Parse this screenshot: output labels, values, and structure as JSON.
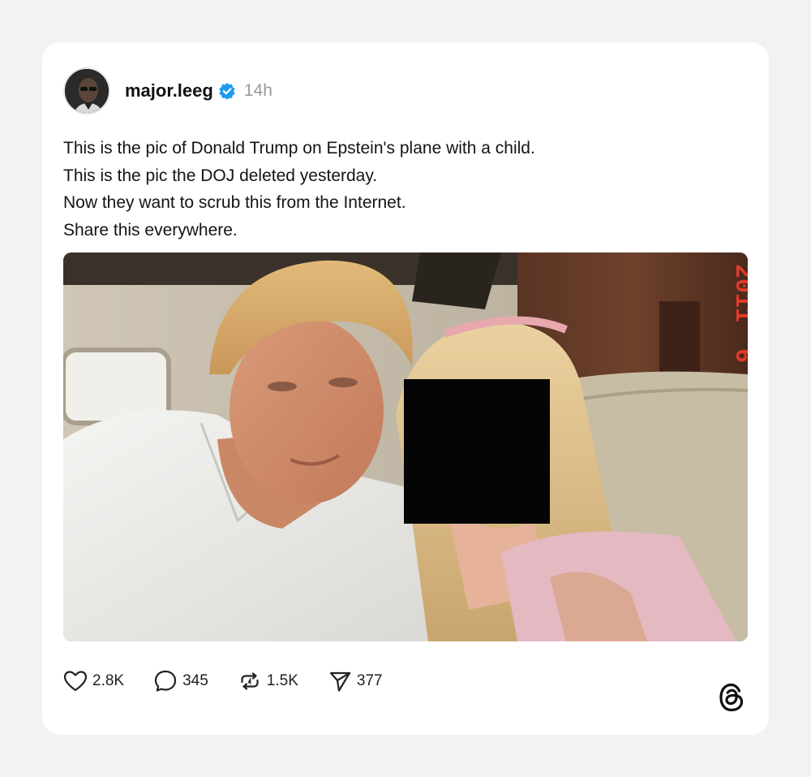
{
  "post": {
    "username": "major.leeg",
    "verified_icon": "verified-badge-icon",
    "time": "14h",
    "text_lines": [
      "This is the pic of Donald Trump on Epstein's plane with a child.",
      "This is the pic the DOJ deleted yesterday.",
      "Now they want to scrub this from the Internet.",
      "Share this everywhere."
    ],
    "media": {
      "timestamp_text": "2011",
      "timestamp_text2": "6"
    }
  },
  "actions": {
    "likes": "2.8K",
    "comments": "345",
    "reposts": "1.5K",
    "shares": "377"
  },
  "colors": {
    "accent_verified": "#1d9bf0",
    "background": "#f2f2f2",
    "card": "#ffffff",
    "muted": "#999999"
  }
}
